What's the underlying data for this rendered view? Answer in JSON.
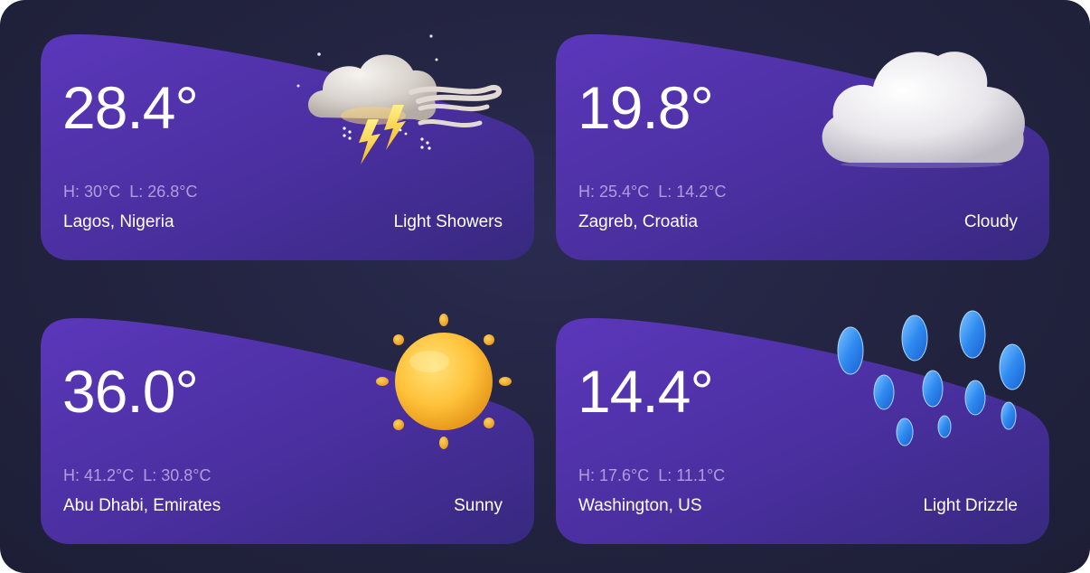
{
  "cards": [
    {
      "temperature": "28.4°",
      "high": "H: 30°C",
      "low": "L: 26.8°C",
      "location": "Lagos, Nigeria",
      "condition": "Light Showers",
      "icon": "thunderstorm-cloud-icon"
    },
    {
      "temperature": "19.8°",
      "high": "H: 25.4°C",
      "low": "L: 14.2°C",
      "location": "Zagreb, Croatia",
      "condition": "Cloudy",
      "icon": "cloud-icon"
    },
    {
      "temperature": "36.0°",
      "high": "H: 41.2°C",
      "low": "L: 30.8°C",
      "location": "Abu Dhabi, Emirates",
      "condition": "Sunny",
      "icon": "sun-icon"
    },
    {
      "temperature": "14.4°",
      "high": "H: 17.6°C",
      "low": "L: 11.1°C",
      "location": "Washington, US",
      "condition": "Light Drizzle",
      "icon": "raindrops-icon"
    }
  ],
  "colors": {
    "background": "#22233f",
    "card_gradient_start": "#5a36b8",
    "card_gradient_end": "#3b2a86",
    "text_primary": "#ffffff",
    "text_secondary": "#b8aee0"
  }
}
